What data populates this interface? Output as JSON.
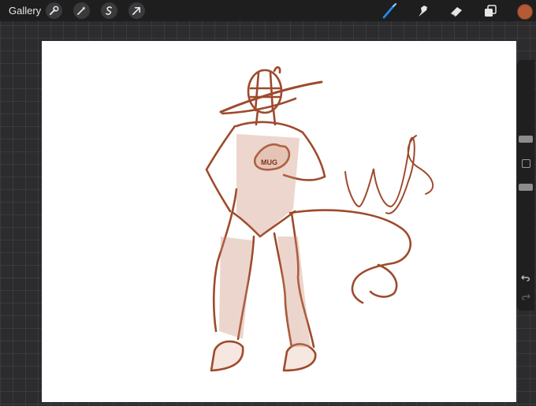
{
  "toolbar": {
    "gallery_label": "Gallery",
    "left_tools": [
      "wrench-icon",
      "magic-wand-icon",
      "selection-s-icon",
      "transform-arrow-icon"
    ],
    "right_tools": [
      "brush-icon",
      "smudge-icon",
      "eraser-icon",
      "layers-icon"
    ],
    "active_tool": "brush-icon"
  },
  "current_color": "#b55a36",
  "sketch": {
    "signature_text": "ugs",
    "mug_label": "MUG"
  },
  "sidebar": {
    "buttons": [
      "brush-size-slider",
      "modify-button",
      "opacity-slider",
      "undo-icon",
      "redo-icon"
    ]
  }
}
